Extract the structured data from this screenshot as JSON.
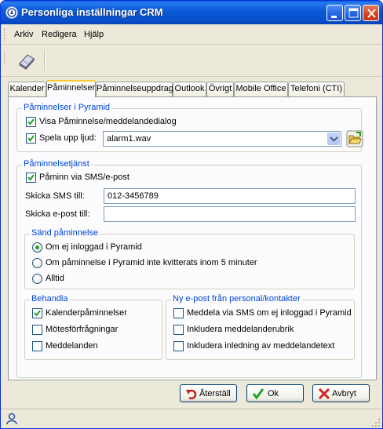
{
  "window": {
    "title": "Personliga inställningar CRM"
  },
  "menu": {
    "items": [
      "Arkiv",
      "Redigera",
      "Hjälp"
    ]
  },
  "tabs": [
    {
      "label": "Kalender",
      "active": false
    },
    {
      "label": "Påminnelser",
      "active": true
    },
    {
      "label": "Påminnelseuppdrag",
      "active": false
    },
    {
      "label": "Outlook",
      "active": false
    },
    {
      "label": "Övrigt",
      "active": false
    },
    {
      "label": "Mobile Office",
      "active": false
    },
    {
      "label": "Telefoni (CTI)",
      "active": false
    }
  ],
  "pyramid_reminders": {
    "title": "Påminnelser i Pyramid",
    "show_dialog": {
      "label": "Visa Påminnelse/meddelandedialog",
      "checked": true
    },
    "play_sound": {
      "label": "Spela upp ljud:",
      "checked": true
    },
    "sound_file": "alarm1.wav"
  },
  "reminder_service": {
    "title": "Påminnelsetjänst",
    "sms_email": {
      "label": "Påminn via SMS/e-post",
      "checked": true
    },
    "sms_label": "Skicka SMS till:",
    "sms_value": "012-3456789",
    "email_label": "Skicka e-post till:",
    "email_value": ""
  },
  "send_reminder": {
    "title": "Sänd påminnelse",
    "options": [
      {
        "label": "Om ej inloggad i Pyramid",
        "selected": true
      },
      {
        "label": "Om påminnelse i Pyramid inte kvitterats inom 5 minuter",
        "selected": false
      },
      {
        "label": "Alltid",
        "selected": false
      }
    ]
  },
  "handle": {
    "title": "Behandla",
    "items": [
      {
        "label": "Kalenderpåminnelser",
        "checked": true
      },
      {
        "label": "Mötesförfrågningar",
        "checked": false
      },
      {
        "label": "Meddelanden",
        "checked": false
      }
    ]
  },
  "new_email": {
    "title": "Ny e-post från personal/kontakter",
    "items": [
      {
        "label": "Meddela via SMS om ej inloggad i Pyramid",
        "checked": false
      },
      {
        "label": "Inkludera meddelanderubrik",
        "checked": false
      },
      {
        "label": "Inkludera inledning av meddelandetext",
        "checked": false
      }
    ]
  },
  "buttons": {
    "reset": "Återställ",
    "ok": "Ok",
    "cancel": "Avbryt"
  },
  "colors": {
    "accent": "#0046d5",
    "titlebar": "#0a5bd9",
    "check": "#21a121"
  }
}
